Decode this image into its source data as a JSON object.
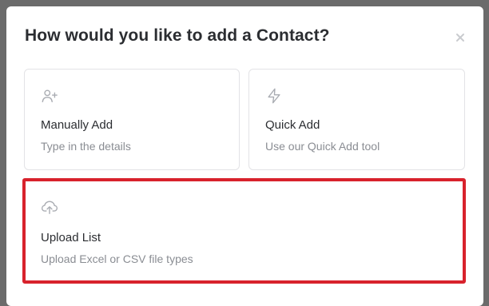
{
  "modal": {
    "title": "How would you like to add a Contact?",
    "close_icon": "close-icon"
  },
  "options": [
    {
      "icon": "user-plus-icon",
      "title": "Manually Add",
      "description": "Type in the details"
    },
    {
      "icon": "lightning-icon",
      "title": "Quick Add",
      "description": "Use our Quick Add tool"
    },
    {
      "icon": "cloud-upload-icon",
      "title": "Upload List",
      "description": "Upload Excel or CSV file types"
    }
  ],
  "colors": {
    "highlight_border": "#d8222c",
    "overlay": "#6b6b6b",
    "icon": "#a9acb2"
  }
}
